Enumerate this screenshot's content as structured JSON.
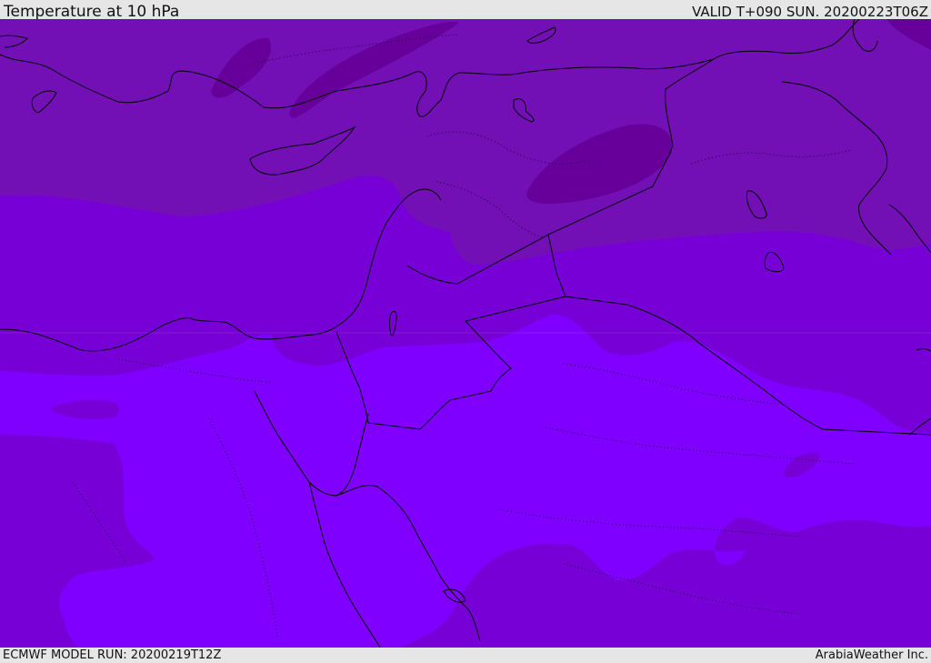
{
  "header": {
    "title": "Temperature at 10 hPa",
    "valid": "VALID T+090 SUN. 20200223T06Z"
  },
  "footer": {
    "model_run": "ECMWF MODEL RUN: 20200219T12Z",
    "brand": "ArabiaWeather Inc."
  },
  "colors": {
    "band_darkest": "#67009a",
    "band_dark": "#7210b6",
    "band_mid": "#7700d6",
    "band_light": "#7f00ff",
    "coastline": "#000000"
  }
}
